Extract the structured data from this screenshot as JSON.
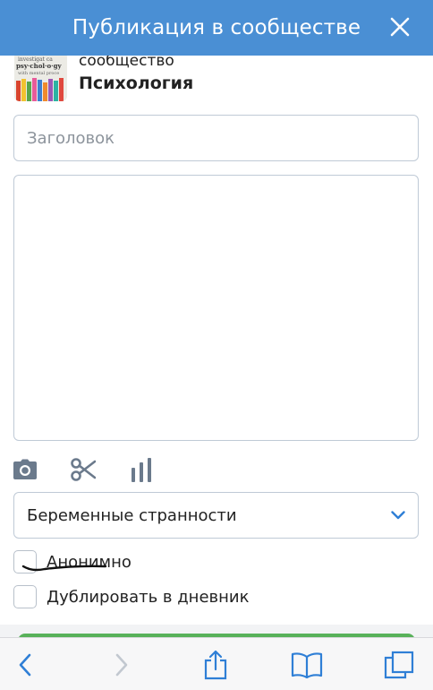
{
  "header": {
    "title": "Публикация в сообществе",
    "close_icon": "close-icon"
  },
  "community": {
    "label": "сообщество",
    "name": "Психология",
    "avatar_icon": "community-avatar-image"
  },
  "form": {
    "title_placeholder": "Заголовок",
    "title_value": "",
    "body_value": "",
    "rubric_selected": "Беременные странности",
    "anonymous_label": "Анонимно",
    "anonymous_checked": false,
    "duplicate_label": "Дублировать в дневник",
    "duplicate_checked": false
  },
  "toolbar": {
    "icons": [
      "camera-icon",
      "scissors-icon",
      "poll-chart-icon"
    ]
  },
  "colors": {
    "header": "#4a8fd4",
    "accent": "#2f7fd6",
    "submit": "#58b15a",
    "browser_icon": "#2f7fd6"
  },
  "browser_bar": {
    "icons": [
      "back-icon",
      "forward-icon",
      "share-icon",
      "bookmarks-icon",
      "tabs-icon"
    ]
  }
}
